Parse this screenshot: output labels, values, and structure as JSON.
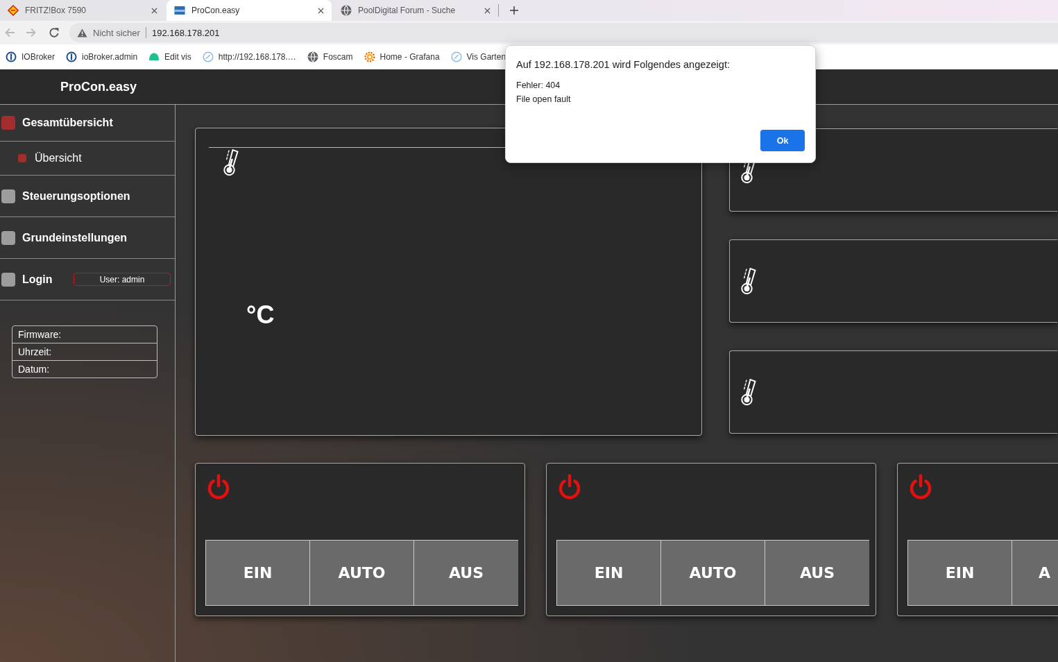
{
  "browser": {
    "tabs": [
      {
        "title": "FRITZ!Box 7590",
        "kind": "logo",
        "selected": false
      },
      {
        "title": "ProCon.easy",
        "kind": "thumbnail",
        "selected": true
      },
      {
        "title": "PoolDigital Forum - Suche",
        "kind": "globe",
        "selected": false
      }
    ],
    "address_bar": {
      "security": "Nicht sicher",
      "url": "192.168.178.201"
    },
    "bookmarks": [
      {
        "label": "IOBroker",
        "kind": "ring"
      },
      {
        "label": "ioBroker.admin",
        "kind": "ring"
      },
      {
        "label": "Edit vis",
        "kind": "dome"
      },
      {
        "label": "http://192.168.178.…",
        "kind": "gauge"
      },
      {
        "label": "Foscam",
        "kind": "globe"
      },
      {
        "label": "Home - Grafana",
        "kind": "gear"
      },
      {
        "label": "Vis Garten",
        "kind": "gauge"
      }
    ]
  },
  "app": {
    "title": "ProCon.easy",
    "nav": [
      {
        "label": "Gesamtübersicht",
        "selected": true,
        "children": [
          {
            "label": "Übersicht",
            "selected": true
          }
        ]
      },
      {
        "label": "Steuerungsoptionen",
        "selected": false
      },
      {
        "label": "Grundeinstellungen",
        "selected": false
      },
      {
        "label": "Login",
        "selected": false,
        "badge": "User: admin"
      }
    ],
    "info": [
      "Firmware:",
      "Uhrzeit:",
      "Datum:"
    ],
    "main_sensor": {
      "kind": "temperature",
      "unit": "°C"
    },
    "side_sensors": [
      {
        "kind": "temperature"
      },
      {
        "kind": "temperature"
      },
      {
        "kind": "temperature"
      }
    ],
    "switches": [
      {
        "on": false,
        "buttons": [
          "EIN",
          "AUTO",
          "AUS"
        ]
      },
      {
        "on": false,
        "buttons": [
          "EIN",
          "AUTO",
          "AUS"
        ]
      },
      {
        "on": false,
        "cut_off": true,
        "buttons": [
          "EIN",
          "A"
        ]
      }
    ]
  },
  "dialog": {
    "title": "Auf 192.168.178.201 wird Folgendes angezeigt:",
    "lines": [
      "Fehler: 404",
      "File open fault"
    ],
    "button": "Ok"
  }
}
